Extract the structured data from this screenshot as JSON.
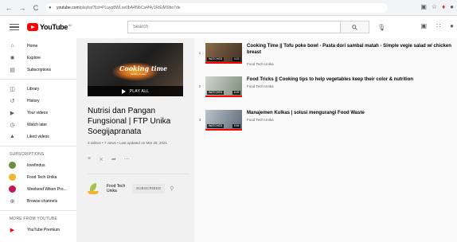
{
  "browser": {
    "back": "←",
    "forward": "→",
    "reload": "C",
    "url_host": "youtube.com",
    "url_path": "/playlist?list=PLuyp8WLoe0bA4f9bCa4f4y1RtEAfI9bo7de",
    "icons": [
      "translate-icon",
      "star-icon",
      "extension-icon",
      "profile-icon"
    ]
  },
  "header": {
    "logo_text": "YouTube",
    "logo_suffix": "ID",
    "search_placeholder": "Search"
  },
  "sidebar": {
    "primary": [
      {
        "label": "Home",
        "icon": "home-icon"
      },
      {
        "label": "Explore",
        "icon": "compass-icon"
      },
      {
        "label": "Subscriptions",
        "icon": "subscriptions-icon"
      }
    ],
    "library": [
      {
        "label": "Library",
        "icon": "library-icon"
      },
      {
        "label": "History",
        "icon": "history-icon"
      },
      {
        "label": "Your videos",
        "icon": "your-videos-icon"
      },
      {
        "label": "Watch later",
        "icon": "watch-later-icon"
      },
      {
        "label": "Liked videos",
        "icon": "like-icon"
      }
    ],
    "subscriptions_heading": "SUBSCRIPTIONS",
    "subscriptions": [
      {
        "label": "lovefindus",
        "color": "#6b8e3d"
      },
      {
        "label": "Food Tech Unika",
        "color": "#f2b632"
      },
      {
        "label": "Weekend Wiken Pro...",
        "color": "#c2185b"
      },
      {
        "label": "Browse channels",
        "color": "#606060"
      }
    ],
    "more_heading": "MORE FROM YOUTUBE",
    "more": [
      {
        "label": "YouTube Premium",
        "icon": "youtube-icon"
      }
    ]
  },
  "playlist": {
    "thumb_title": "Cooking time",
    "thumb_subtitle": "healthy & easy",
    "play_all": "PLAY ALL",
    "title": "Nutrisi dan Pangan Fungsional | FTP Unika Soegijapranata",
    "meta": "3 videos • 7 views • Last updated on Mar 28, 2021",
    "owner_name": "Food Tech Unika",
    "subscribed_label": "SUBSCRIBED"
  },
  "videos": [
    {
      "index": "1",
      "title": "Cooking Time || Tofu poke bowl - Pasta dori sambal matah - Simple vegie salad w/ chicken breast",
      "channel": "Food Tech Unika",
      "badge": "WATCHED",
      "duration": "4:23",
      "progress": 1.0,
      "colors": [
        "#8a6a4a",
        "#3e2f22"
      ]
    },
    {
      "index": "2",
      "title": "Food Tricks || Cooking tips to help vegetables keep their color & nutrition",
      "channel": "Food Tech Unika",
      "badge": "WATCHED",
      "duration": "6:09",
      "progress": 1.0,
      "colors": [
        "#cfd6d0",
        "#7d8a7a"
      ]
    },
    {
      "index": "3",
      "title": "Manajemen Kulkas | solusi mengurangi Food Waste",
      "channel": "Food Tech Unika",
      "badge": "WATCHED",
      "duration": "5:59",
      "progress": 1.0,
      "colors": [
        "#b9c4cc",
        "#5d6a73"
      ]
    }
  ]
}
